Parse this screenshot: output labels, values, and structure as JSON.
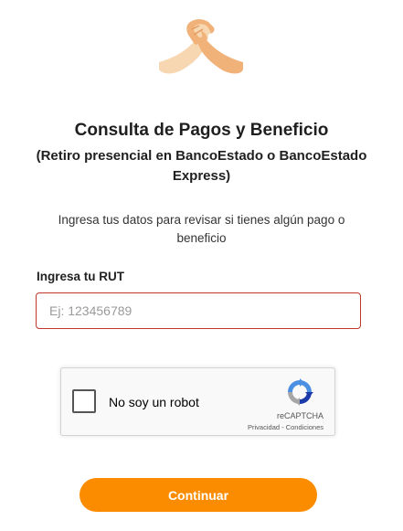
{
  "header": {
    "logo_icon": "handshake-icon",
    "title": "Consulta de Pagos y Beneficio",
    "subtitle": "(Retiro presencial en BancoEstado o BancoEstado Express)",
    "intro": "Ingresa tus datos para revisar si tienes algún pago o beneficio"
  },
  "form": {
    "rut_label": "Ingresa tu RUT",
    "rut_value": "",
    "rut_placeholder": "Ej: 123456789",
    "error_color": "#c0362c"
  },
  "captcha": {
    "checkbox_label": "No soy un robot",
    "checked": false,
    "brand": "reCAPTCHA",
    "privacy_link": "Privacidad",
    "separator": " - ",
    "terms_link": "Condiciones",
    "logo_icon": "recaptcha-icon"
  },
  "actions": {
    "continue_label": "Continuar",
    "accent_color": "#fb8c00"
  }
}
